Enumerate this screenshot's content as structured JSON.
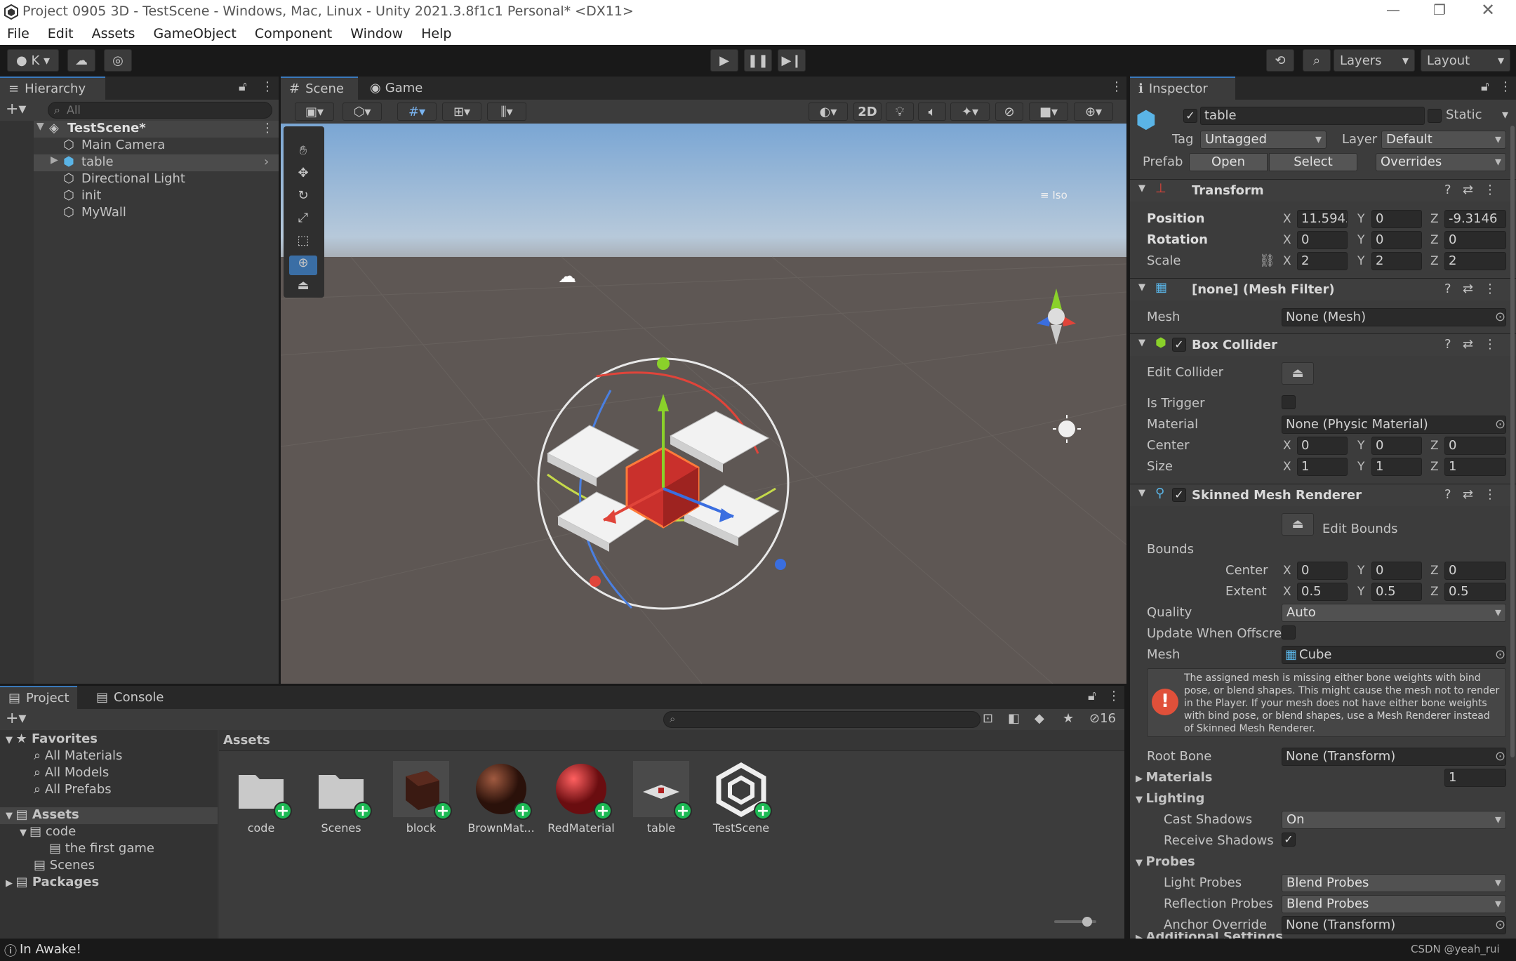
{
  "window": {
    "title": "Project 0905 3D - TestScene - Windows, Mac, Linux - Unity 2021.3.8f1c1 Personal* <DX11>"
  },
  "menu": [
    "File",
    "Edit",
    "Assets",
    "GameObject",
    "Component",
    "Window",
    "Help"
  ],
  "toolbar": {
    "account": "K",
    "layers": "Layers",
    "layout": "Layout"
  },
  "hierarchy": {
    "tab": "Hierarchy",
    "search_placeholder": "All",
    "scene": "TestScene*",
    "items": [
      "Main Camera",
      "table",
      "Directional Light",
      "init",
      "MyWall"
    ]
  },
  "scene_view": {
    "tabs": [
      "Scene",
      "Game"
    ],
    "mode_2d": "2D",
    "persp_label": "Iso"
  },
  "project": {
    "tabs": [
      "Project",
      "Console"
    ],
    "favorites": "Favorites",
    "fav_items": [
      "All Materials",
      "All Models",
      "All Prefabs"
    ],
    "assets_root": "Assets",
    "tree": [
      "code",
      "the first game",
      "Scenes"
    ],
    "packages": "Packages",
    "breadcrumb": "Assets",
    "hidden_count": "16",
    "assets": [
      {
        "name": "code",
        "kind": "folder"
      },
      {
        "name": "Scenes",
        "kind": "folder"
      },
      {
        "name": "block",
        "kind": "block"
      },
      {
        "name": "BrownMat...",
        "kind": "brown"
      },
      {
        "name": "RedMaterial",
        "kind": "red"
      },
      {
        "name": "table",
        "kind": "table"
      },
      {
        "name": "TestScene",
        "kind": "unity"
      }
    ]
  },
  "inspector": {
    "tab": "Inspector",
    "object_name": "table",
    "static_label": "Static",
    "tag_label": "Tag",
    "tag_value": "Untagged",
    "layer_label": "Layer",
    "layer_value": "Default",
    "prefab_label": "Prefab",
    "prefab_open": "Open",
    "prefab_select": "Select",
    "prefab_overrides": "Overrides",
    "transform": {
      "title": "Transform",
      "position_label": "Position",
      "rotation_label": "Rotation",
      "scale_label": "Scale",
      "position": [
        "11.5945",
        "0",
        "-9.3146"
      ],
      "rotation": [
        "0",
        "0",
        "0"
      ],
      "scale": [
        "2",
        "2",
        "2"
      ]
    },
    "mesh_filter": {
      "title": "[none] (Mesh Filter)",
      "mesh_label": "Mesh",
      "mesh_value": "None (Mesh)"
    },
    "box_collider": {
      "title": "Box Collider",
      "edit_label": "Edit Collider",
      "trigger_label": "Is Trigger",
      "material_label": "Material",
      "material_value": "None (Physic Material)",
      "center_label": "Center",
      "center": [
        "0",
        "0",
        "0"
      ],
      "size_label": "Size",
      "size": [
        "1",
        "1",
        "1"
      ]
    },
    "skinned": {
      "title": "Skinned Mesh Renderer",
      "edit_bounds": "Edit Bounds",
      "bounds_label": "Bounds",
      "center_label": "Center",
      "center": [
        "0",
        "0",
        "0"
      ],
      "extent_label": "Extent",
      "extent": [
        "0.5",
        "0.5",
        "0.5"
      ],
      "quality_label": "Quality",
      "quality_value": "Auto",
      "update_label": "Update When Offscre",
      "mesh_label": "Mesh",
      "mesh_value": "Cube",
      "warning": "The assigned mesh is missing either bone weights with bind pose, or blend shapes. This might cause the mesh not to render in the Player. If your mesh does not have either bone weights with bind pose, or blend shapes, use a Mesh Renderer instead of Skinned Mesh Renderer.",
      "root_bone_label": "Root Bone",
      "root_bone_value": "None (Transform)",
      "materials_label": "Materials",
      "materials_count": "1",
      "lighting_label": "Lighting",
      "cast_label": "Cast Shadows",
      "cast_value": "On",
      "receive_label": "Receive Shadows",
      "probes_label": "Probes",
      "light_probes_label": "Light Probes",
      "light_probes_value": "Blend Probes",
      "reflection_label": "Reflection Probes",
      "reflection_value": "Blend Probes",
      "anchor_label": "Anchor Override",
      "anchor_value": "None (Transform)",
      "additional_label": "Additional Settings"
    }
  },
  "status": {
    "message": "In Awake!",
    "watermark": "CSDN @yeah_rui"
  }
}
